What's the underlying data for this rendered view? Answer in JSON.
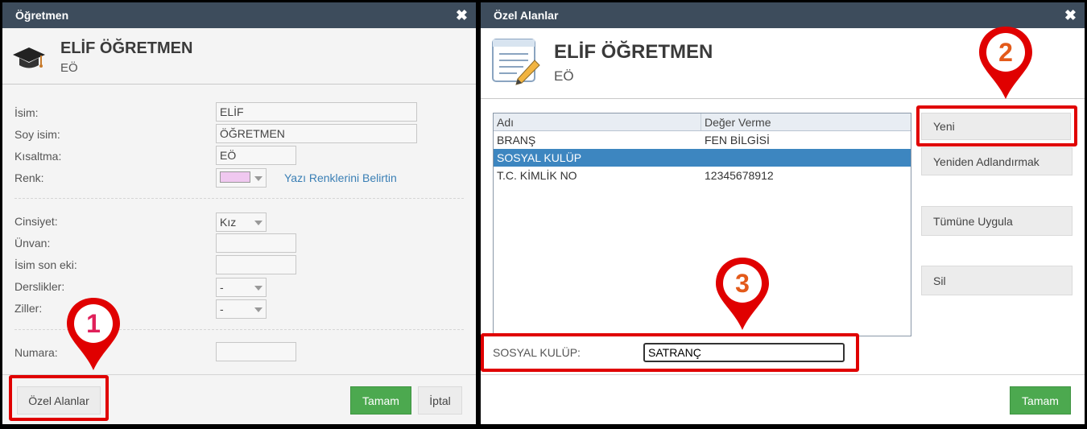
{
  "left_dialog": {
    "title": "Öğretmen",
    "header": {
      "name": "ELİF ÖĞRETMEN",
      "short": "EÖ"
    },
    "fields": {
      "isim_label": "İsim:",
      "isim_value": "ELİF",
      "soyisim_label": "Soy isim:",
      "soyisim_value": "ÖĞRETMEN",
      "kisaltma_label": "Kısaltma:",
      "kisaltma_value": "EÖ",
      "renk_label": "Renk:",
      "renk_color": "#f0c8f0",
      "renk_link": "Yazı Renklerini Belirtin",
      "cinsiyet_label": "Cinsiyet:",
      "cinsiyet_value": "Kız",
      "unvan_label": "Ünvan:",
      "unvan_value": "",
      "isimsoneki_label": "İsim son eki:",
      "isimsoneki_value": "",
      "derslikler_label": "Derslikler:",
      "derslikler_value": "-",
      "ziller_label": "Ziller:",
      "ziller_value": "-",
      "numara_label": "Numara:",
      "numara_value": ""
    },
    "buttons": {
      "ozel_alanlar": "Özel Alanlar",
      "tamam": "Tamam",
      "iptal": "İptal"
    }
  },
  "right_dialog": {
    "title": "Özel Alanlar",
    "header": {
      "name": "ELİF ÖĞRETMEN",
      "short": "EÖ"
    },
    "table": {
      "columns": [
        "Adı",
        "Değer Verme"
      ],
      "rows": [
        {
          "name": "BRANŞ",
          "value": "FEN BİLGİSİ"
        },
        {
          "name": "SOSYAL KULÜP",
          "value": ""
        },
        {
          "name": "T.C. KİMLİK NO",
          "value": "12345678912"
        }
      ]
    },
    "buttons": {
      "yeni": "Yeni",
      "yeniden": "Yeniden Adlandırmak",
      "tumune": "Tümüne Uygula",
      "sil": "Sil",
      "tamam": "Tamam"
    },
    "edit": {
      "label": "SOSYAL KULÜP:",
      "value": "SATRANÇ"
    }
  },
  "annotations": {
    "pin1": "1",
    "pin2": "2",
    "pin3": "3",
    "pin_color": "#e00000",
    "number_color": "#d23a2a"
  }
}
